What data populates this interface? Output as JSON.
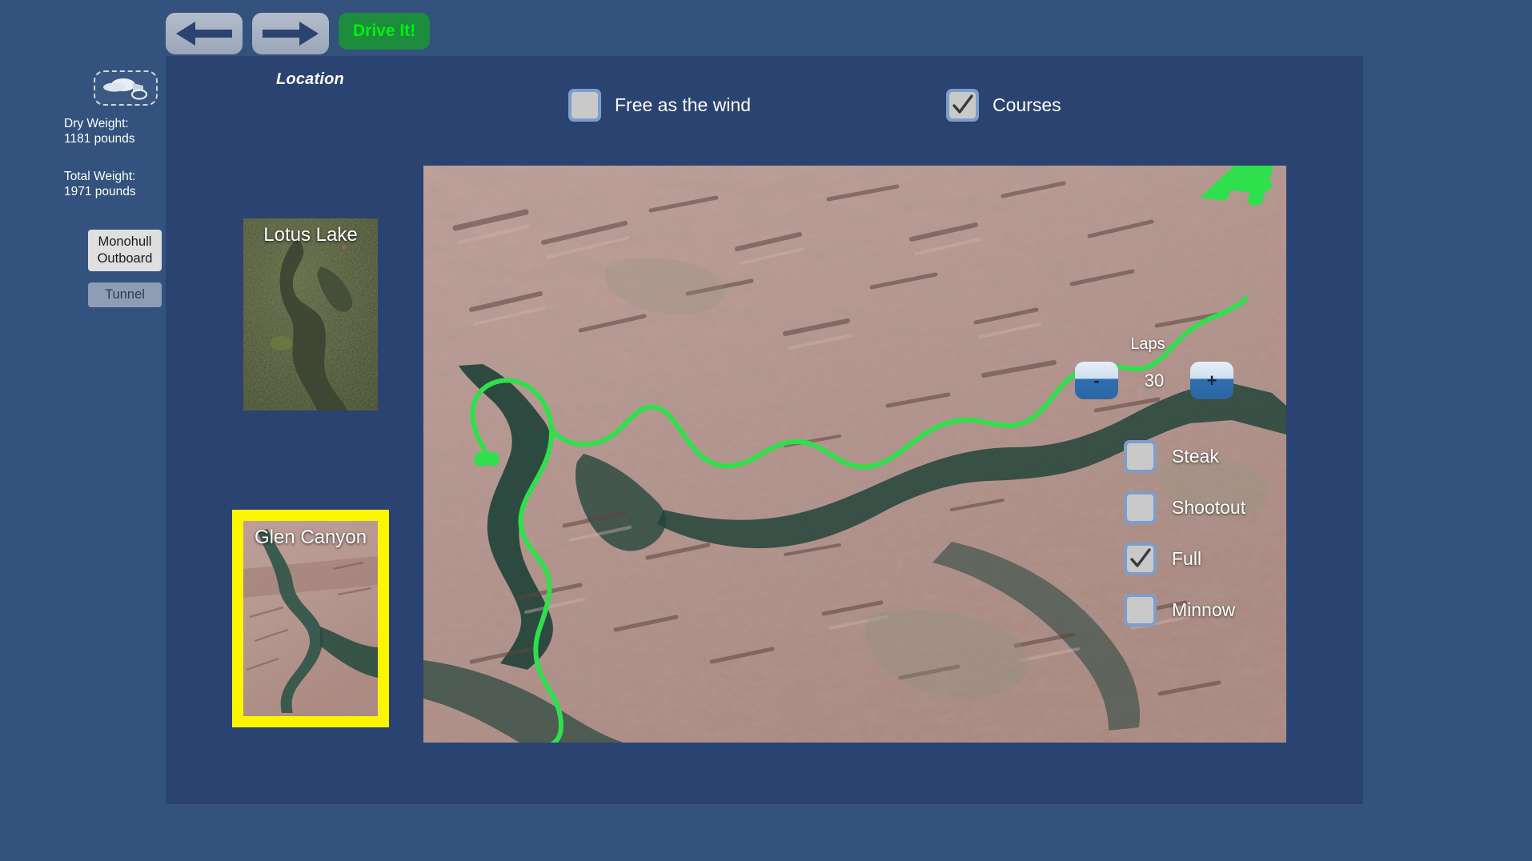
{
  "toolbar": {
    "back_icon": "arrow-left-icon",
    "forward_icon": "arrow-right-icon",
    "drive_label": "Drive It!"
  },
  "panel": {
    "section_label": "Location"
  },
  "sidebar": {
    "boat_icon": "boat-thumbnail-icon",
    "dry_weight_label": "Dry Weight:",
    "dry_weight_value": "1181 pounds",
    "total_weight_label": "Total Weight:",
    "total_weight_value": "1971 pounds",
    "hull_buttons": [
      {
        "label": "Monohull Outboard",
        "selected": true
      },
      {
        "label": "Tunnel",
        "selected": false
      }
    ]
  },
  "modes": [
    {
      "label": "Free as the wind",
      "checked": false
    },
    {
      "label": "Courses",
      "checked": true
    }
  ],
  "locations": [
    {
      "name": "Lotus Lake",
      "selected": false
    },
    {
      "name": "Glen Canyon",
      "selected": true
    }
  ],
  "laps": {
    "title": "Laps",
    "value": "30",
    "decrease_label": "-",
    "increase_label": "+"
  },
  "race_types": [
    {
      "label": "Steak",
      "checked": false
    },
    {
      "label": "Shootout",
      "checked": false
    },
    {
      "label": "Full",
      "checked": true
    },
    {
      "label": "Minnow",
      "checked": false
    }
  ],
  "colors": {
    "background": "#33527d",
    "panel": "#2b4370",
    "drive_button": "#1d8c3c",
    "drive_text": "#01ef14",
    "selection_highlight": "#fcf500",
    "course_route": "#2fe04c",
    "checkbox_frame": "#7d9ec9"
  }
}
